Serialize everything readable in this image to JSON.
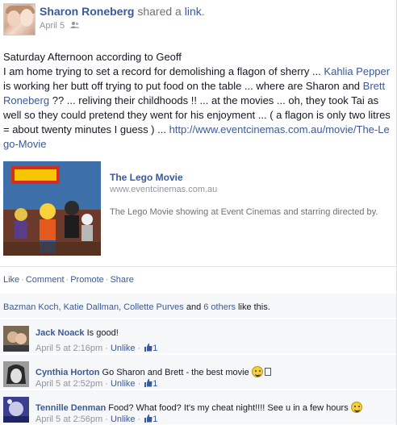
{
  "post": {
    "author": "Sharon Roneberg",
    "action_text": " shared a ",
    "action_link": "link",
    "action_end": ".",
    "date": "April 5",
    "privacy_icon": "friends-icon",
    "text": {
      "line1": "Saturday Afternoon according to Geoff",
      "p1": "I am home trying to set a record for demolishing a flagon of sherry ... ",
      "tag1": "Kahlia Pepper",
      "p2": " is working her butt off trying to put food on the table ... where are Sharon and ",
      "tag2": "Brett Roneberg",
      "p3": " ?? ... reliving their childhoods !! ... at the movies ... oh, they took Tai as well so they could pretend they went for his enjoyment ... ( a flagon is only two litres = about twenty minutes I guess ) ... ",
      "url": "http://www.eventcinemas.com.au/movie/The-Lego-Movie"
    },
    "share": {
      "title": "The Lego Movie",
      "domain": "www.eventcinemas.com.au",
      "description": "The Lego Movie showing at Event Cinemas and starring directed by."
    },
    "actions": {
      "like": "Like",
      "comment": "Comment",
      "promote": "Promote",
      "share": "Share",
      "sep": "·"
    },
    "likes": {
      "names": "Bazman Koch, Katie Dallman, Collette Purves",
      "and": " and ",
      "others": "6 others",
      "suffix": " like this."
    }
  },
  "comments": [
    {
      "author": "Jack Noack",
      "text": "Is good!",
      "time": "April 5 at 2:16pm",
      "unlike": "Unlike",
      "likes": "1"
    },
    {
      "author": "Cynthia Horton",
      "text": "Go Sharon and Brett - the best movie",
      "time": "April 5 at 2:52pm",
      "unlike": "Unlike",
      "likes": "1"
    },
    {
      "author": "Tennille Denman",
      "text": "Food? What food? It's my cheat night!!!! See u in a few hours",
      "time": "April 5 at 2:56pm",
      "unlike": "Unlike",
      "likes": "1"
    }
  ],
  "colors": {
    "link": "#3b5998",
    "muted": "#90949c",
    "panel": "#f6f7f9"
  }
}
